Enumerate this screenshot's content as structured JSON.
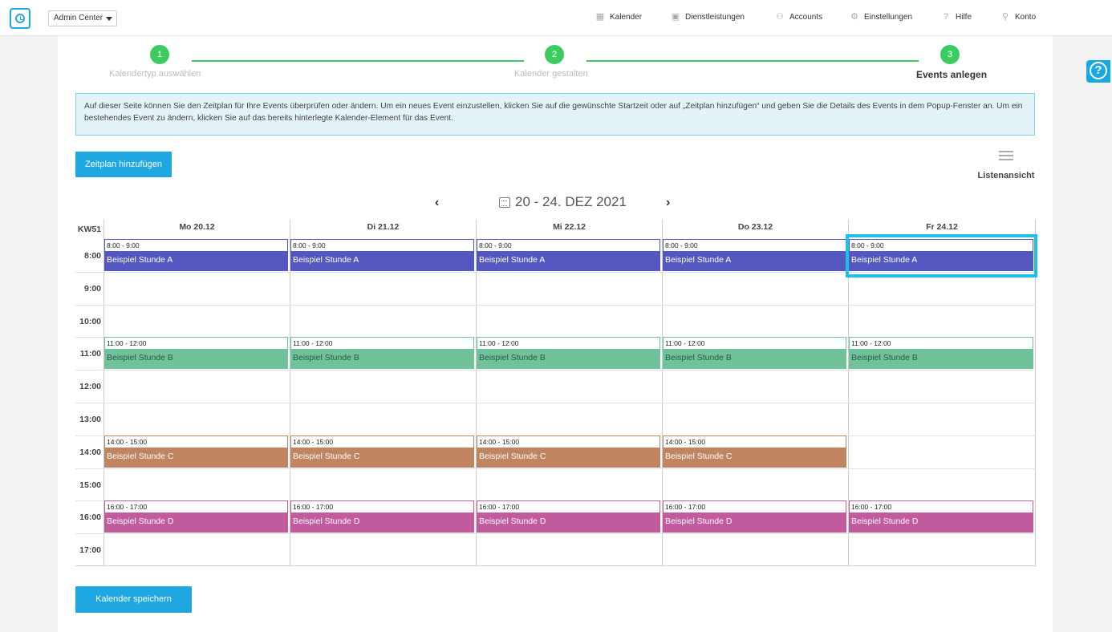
{
  "header": {
    "admin_select": "Admin Center",
    "nav": [
      {
        "label": "Kalender",
        "icon": "calendar-icon"
      },
      {
        "label": "Dienstleistungen",
        "icon": "grid-icon"
      },
      {
        "label": "Accounts",
        "icon": "users-icon"
      },
      {
        "label": "Einstellungen",
        "icon": "gear-icon"
      },
      {
        "label": "Hilfe",
        "icon": "question-icon"
      },
      {
        "label": "Konto",
        "icon": "user-icon"
      }
    ]
  },
  "steps": [
    {
      "number": "1",
      "label": "Kalendertyp auswählen"
    },
    {
      "number": "2",
      "label": "Kalender gestalten"
    },
    {
      "number": "3",
      "label": "Events anlegen"
    }
  ],
  "info_text": "Auf dieser Seite können Sie den Zeitplan für Ihre Events überprüfen oder ändern. Um ein neues Event einzustellen, klicken Sie auf die gewünschte Startzeit oder auf „Zeitplan hinzufügen“ und geben Sie die Details des Events in dem Popup-Fenster an. Um ein bestehendes Event zu ändern, klicken Sie auf das bereits hinterlegte Kalender-Element für das Event.",
  "add_button": "Zeitplan hinzufügen",
  "list_view_label": "Listenansicht",
  "week_range": "20 - 24. DEZ 2021",
  "calendar": {
    "week_label": "KW51",
    "days": [
      "Mo 20.12",
      "Di 21.12",
      "Mi 22.12",
      "Do 23.12",
      "Fr 24.12"
    ],
    "hours": [
      "8:00",
      "9:00",
      "10:00",
      "11:00",
      "12:00",
      "13:00",
      "14:00",
      "15:00",
      "16:00",
      "17:00"
    ],
    "events": [
      {
        "day": 0,
        "hour": 0,
        "type": "A",
        "time": "8:00 - 9:00",
        "name": "Beispiel Stunde A"
      },
      {
        "day": 1,
        "hour": 0,
        "type": "A",
        "time": "8:00 - 9:00",
        "name": "Beispiel Stunde A"
      },
      {
        "day": 2,
        "hour": 0,
        "type": "A",
        "time": "8:00 - 9:00",
        "name": "Beispiel Stunde A"
      },
      {
        "day": 3,
        "hour": 0,
        "type": "A",
        "time": "8:00 - 9:00",
        "name": "Beispiel Stunde A"
      },
      {
        "day": 4,
        "hour": 0,
        "type": "A",
        "time": "8:00 - 9:00",
        "name": "Beispiel Stunde A"
      },
      {
        "day": 0,
        "hour": 3,
        "type": "B",
        "time": "11:00 - 12:00",
        "name": "Beispiel Stunde B"
      },
      {
        "day": 1,
        "hour": 3,
        "type": "B",
        "time": "11:00 - 12:00",
        "name": "Beispiel Stunde B"
      },
      {
        "day": 2,
        "hour": 3,
        "type": "B",
        "time": "11:00 - 12:00",
        "name": "Beispiel Stunde B"
      },
      {
        "day": 3,
        "hour": 3,
        "type": "B",
        "time": "11:00 - 12:00",
        "name": "Beispiel Stunde B"
      },
      {
        "day": 4,
        "hour": 3,
        "type": "B",
        "time": "11:00 - 12:00",
        "name": "Beispiel Stunde B"
      },
      {
        "day": 0,
        "hour": 6,
        "type": "C",
        "time": "14:00 - 15:00",
        "name": "Beispiel Stunde C"
      },
      {
        "day": 1,
        "hour": 6,
        "type": "C",
        "time": "14:00 - 15:00",
        "name": "Beispiel Stunde C"
      },
      {
        "day": 2,
        "hour": 6,
        "type": "C",
        "time": "14:00 - 15:00",
        "name": "Beispiel Stunde C"
      },
      {
        "day": 3,
        "hour": 6,
        "type": "C",
        "time": "14:00 - 15:00",
        "name": "Beispiel Stunde C"
      },
      {
        "day": 0,
        "hour": 8,
        "type": "D",
        "time": "16:00 - 17:00",
        "name": "Beispiel Stunde D"
      },
      {
        "day": 1,
        "hour": 8,
        "type": "D",
        "time": "16:00 - 17:00",
        "name": "Beispiel Stunde D"
      },
      {
        "day": 2,
        "hour": 8,
        "type": "D",
        "time": "16:00 - 17:00",
        "name": "Beispiel Stunde D"
      },
      {
        "day": 3,
        "hour": 8,
        "type": "D",
        "time": "16:00 - 17:00",
        "name": "Beispiel Stunde D"
      },
      {
        "day": 4,
        "hour": 8,
        "type": "D",
        "time": "16:00 - 17:00",
        "name": "Beispiel Stunde D"
      }
    ]
  },
  "save_button": "Kalender speichern",
  "colors": {
    "accent": "#1ea7e1",
    "step_green": "#3ccb5e",
    "event_a": "#5457bf",
    "event_b": "#6fc299",
    "event_c": "#c08460",
    "event_d": "#c25a9e",
    "highlight": "#1fbfe8"
  }
}
